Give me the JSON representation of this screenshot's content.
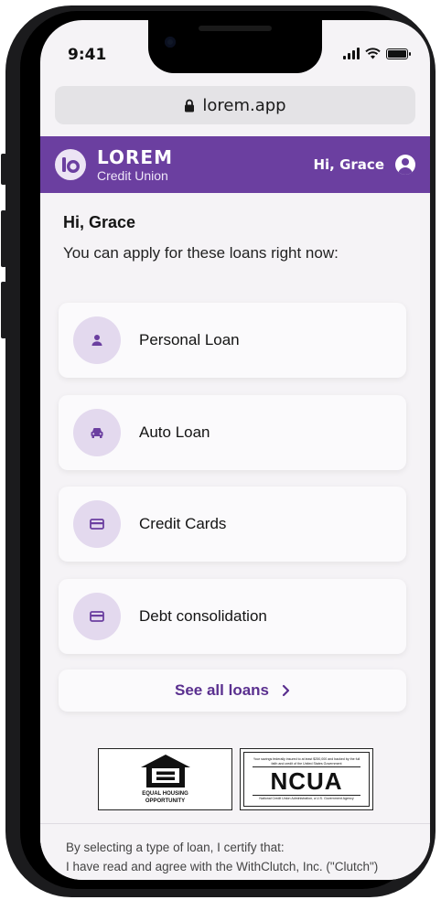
{
  "status_bar": {
    "time": "9:41"
  },
  "browser": {
    "url": "lorem.app"
  },
  "header": {
    "brand_name": "LOREM",
    "brand_sub": "Credit Union",
    "greeting": "Hi, Grace"
  },
  "main": {
    "greeting": "Hi, Grace",
    "intro": "You can apply for these loans right now:",
    "loans": [
      {
        "label": "Personal Loan",
        "icon": "person-icon"
      },
      {
        "label": "Auto Loan",
        "icon": "car-icon"
      },
      {
        "label": "Credit Cards",
        "icon": "credit-card-icon"
      },
      {
        "label": "Debt consolidation",
        "icon": "credit-card-icon"
      }
    ],
    "see_all": "See all loans"
  },
  "badges": {
    "ehl_line1": "EQUAL HOUSING",
    "ehl_line2": "OPPORTUNITY",
    "ncua_top": "Your savings federally insured to at least $250,000 and backed by the full faith and credit of the United States Government",
    "ncua_name": "NCUA",
    "ncua_bottom": "National Credit Union Administration, a U.S. Government Agency"
  },
  "footer": {
    "line1": "By selecting a type of loan, I certify that:",
    "line2": "I have read and agree with the WithClutch, Inc. (\"Clutch\")"
  },
  "colors": {
    "brand": "#6b3fa0",
    "icon_bg": "#e3d9ee",
    "link": "#5a2f8f"
  }
}
